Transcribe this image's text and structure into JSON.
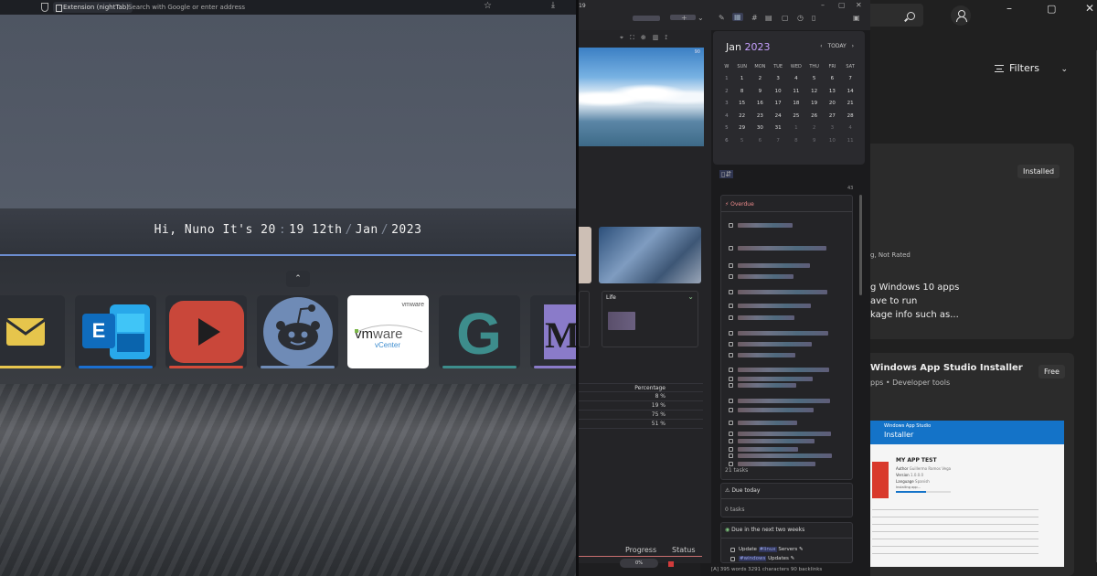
{
  "browser": {
    "ext_label": "Extension (nightTab)",
    "search_placeholder": "Search with Google or enter address",
    "greeting": {
      "hi": "Hi, Nuno",
      "its": "It's",
      "hour": "20",
      "min": "19",
      "day": "12th",
      "month": "Jan",
      "year": "2023",
      "sep_time": ":",
      "sep_date": "/"
    },
    "collapse_icon": "chevron-up-icon",
    "tiles": [
      {
        "name": "mail",
        "icon": "envelope-icon",
        "accent": "#e8c64e"
      },
      {
        "name": "exchange",
        "icon": "exchange-icon",
        "accent": "#1b6fd0"
      },
      {
        "name": "youtube",
        "icon": "play-icon",
        "accent": "#d24b3a"
      },
      {
        "name": "reddit",
        "icon": "reddit-icon",
        "accent": "#6f8bb6"
      },
      {
        "name": "vmware",
        "icon": "vmware-icon",
        "accent": "#ffffff",
        "label_top": "vmware",
        "label_main": "vmware",
        "label_sub": "vCenter"
      },
      {
        "name": "google",
        "icon": "g-icon",
        "accent": "#3d8d8c"
      },
      {
        "name": "medium",
        "icon": "m-icon",
        "accent": "#8a7bc9"
      }
    ]
  },
  "obsidian": {
    "title_frag": "19",
    "image_badge": "90",
    "card_life": "Life",
    "table_header": "Percentage",
    "table_values": [
      "8 %",
      "19 %",
      "75 %",
      "51 %"
    ],
    "progress_label": "Progress",
    "status_label": "Status",
    "progress_value": "0%",
    "calendar": {
      "month": "Jan",
      "year": "2023",
      "today": "TODAY",
      "headers": [
        "W",
        "SUN",
        "MON",
        "TUE",
        "WED",
        "THU",
        "FRI",
        "SAT"
      ],
      "rows": [
        [
          "1",
          "1",
          "2",
          "3",
          "4",
          "5",
          "6",
          "7"
        ],
        [
          "2",
          "8",
          "9",
          "10",
          "11",
          "12",
          "13",
          "14"
        ],
        [
          "3",
          "15",
          "16",
          "17",
          "18",
          "19",
          "20",
          "21"
        ],
        [
          "4",
          "22",
          "23",
          "24",
          "25",
          "26",
          "27",
          "28"
        ],
        [
          "5",
          "29",
          "30",
          "31",
          "1",
          "2",
          "3",
          "4"
        ],
        [
          "6",
          "5",
          "6",
          "7",
          "8",
          "9",
          "10",
          "11"
        ]
      ]
    },
    "tasks_count_badge": "43",
    "overdue_label": "Overdue",
    "overdue_count": "21 tasks",
    "due_today_label": "Due today",
    "due_today_count": "0 tasks",
    "next_two_weeks_label": "Due in the next two weeks",
    "next_tasks": [
      {
        "text": "Update",
        "tag": "#linux",
        "rest": "Servers"
      },
      {
        "text": "",
        "tag": "#windows",
        "rest": "Updates"
      }
    ],
    "statusbar": "[A]   395 words 3291 characters   90 backlinks"
  },
  "store": {
    "filters_label": "Filters",
    "installed_badge": "Installed",
    "not_rated": "g, Not Rated",
    "desc_line1": "g Windows 10 apps",
    "desc_line2": "ave to run",
    "desc_line3": "kage info such as...",
    "app2_title": "Windows App Studio Installer",
    "app2_sub": "pps • Developer tools",
    "free_badge": "Free",
    "shot_header_small": "Windows App Studio",
    "shot_header_big": "Installer",
    "shot_app_title": "MY APP TEST",
    "shot_author": "Author",
    "shot_author_val": "Guillermo Ramos Vega",
    "shot_version": "Version",
    "shot_version_val": "1.0.0.0",
    "shot_language": "Language",
    "shot_language_val": "Spanish",
    "shot_installing": "Installing app..."
  }
}
